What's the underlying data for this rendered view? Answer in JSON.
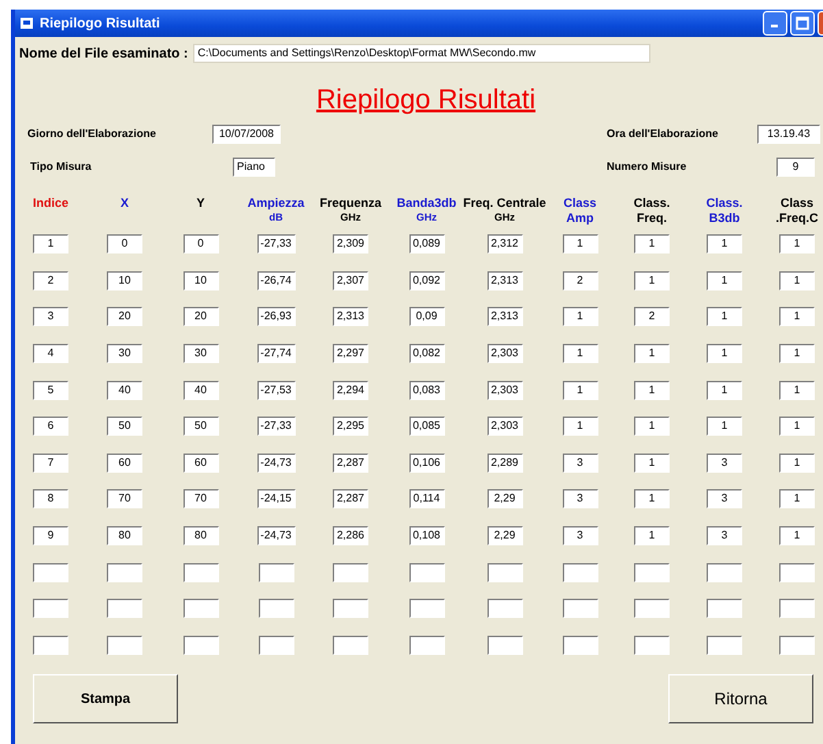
{
  "window": {
    "title": "Riepilogo Risultati"
  },
  "file_label": "Nome del File esaminato :",
  "file_value": "C:\\Documents and Settings\\Renzo\\Desktop\\Format MW\\Secondo.mw",
  "heading": "Riepilogo Risultati",
  "info": {
    "day_label": "Giorno dell'Elaborazione",
    "day_value": "10/07/2008",
    "time_label": "Ora dell'Elaborazione",
    "time_value": "13.19.43",
    "type_label": "Tipo Misura",
    "type_value": "Piano",
    "count_label": "Numero Misure",
    "count_value": "9"
  },
  "table": {
    "columns": [
      {
        "title": "Indice",
        "color": "#e01010"
      },
      {
        "title": "X",
        "color": "#1a1ad0"
      },
      {
        "title": "Y",
        "color": "#000000"
      },
      {
        "title": "Ampiezza",
        "unit": "dB",
        "color": "#1a1ad0"
      },
      {
        "title": "Frequenza",
        "unit": "GHz",
        "color": "#000000"
      },
      {
        "title": "Banda3db",
        "unit": "GHz",
        "color": "#1a1ad0"
      },
      {
        "title": "Freq. Centrale",
        "unit": "GHz",
        "color": "#000000"
      },
      {
        "title": "Class",
        "unit": "Amp",
        "color": "#1a1ad0"
      },
      {
        "title": "Class.",
        "unit": "Freq.",
        "color": "#000000"
      },
      {
        "title": "Class.",
        "unit": "B3db",
        "color": "#1a1ad0"
      },
      {
        "title": "Class",
        "unit": ".Freq.C",
        "color": "#000000"
      }
    ],
    "rows": [
      {
        "kind": "filled",
        "cells": [
          "1",
          "0",
          "0",
          "-27,33",
          "2,309",
          "0,089",
          "2,312",
          "1",
          "1",
          "1",
          "1"
        ]
      },
      {
        "kind": "filled",
        "cells": [
          "2",
          "10",
          "10",
          "-26,74",
          "2,307",
          "0,092",
          "2,313",
          "2",
          "1",
          "1",
          "1"
        ]
      },
      {
        "kind": "filled",
        "cells": [
          "3",
          "20",
          "20",
          "-26,93",
          "2,313",
          "0,09",
          "2,313",
          "1",
          "2",
          "1",
          "1"
        ]
      },
      {
        "kind": "filled",
        "cells": [
          "4",
          "30",
          "30",
          "-27,74",
          "2,297",
          "0,082",
          "2,303",
          "1",
          "1",
          "1",
          "1"
        ]
      },
      {
        "kind": "filled",
        "cells": [
          "5",
          "40",
          "40",
          "-27,53",
          "2,294",
          "0,083",
          "2,303",
          "1",
          "1",
          "1",
          "1"
        ]
      },
      {
        "kind": "filled",
        "cells": [
          "6",
          "50",
          "50",
          "-27,33",
          "2,295",
          "0,085",
          "2,303",
          "1",
          "1",
          "1",
          "1"
        ]
      },
      {
        "kind": "filled",
        "cells": [
          "7",
          "60",
          "60",
          "-24,73",
          "2,287",
          "0,106",
          "2,289",
          "3",
          "1",
          "3",
          "1"
        ]
      },
      {
        "kind": "filled",
        "cells": [
          "8",
          "70",
          "70",
          "-24,15",
          "2,287",
          "0,114",
          "2,29",
          "3",
          "1",
          "3",
          "1"
        ]
      },
      {
        "kind": "filled",
        "cells": [
          "9",
          "80",
          "80",
          "-24,73",
          "2,286",
          "0,108",
          "2,29",
          "3",
          "1",
          "3",
          "1"
        ]
      },
      {
        "kind": "empty"
      },
      {
        "kind": "empty"
      },
      {
        "kind": "empty"
      }
    ]
  },
  "buttons": [
    {
      "label": "Stampa",
      "kind": "small"
    },
    {
      "label": "Ritorna",
      "kind": "large"
    }
  ]
}
